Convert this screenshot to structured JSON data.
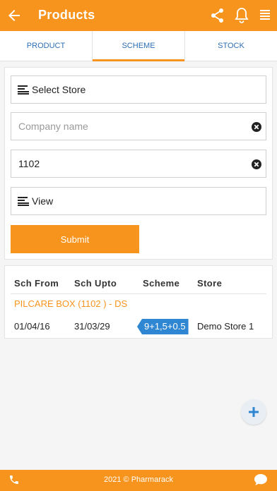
{
  "header": {
    "title": "Products",
    "icons": [
      "back-arrow-icon",
      "share-icon",
      "bell-icon",
      "menu-icon"
    ]
  },
  "tabs": [
    {
      "label": "PRODUCT",
      "active": false
    },
    {
      "label": "SCHEME",
      "active": true
    },
    {
      "label": "STOCK",
      "active": false
    }
  ],
  "form": {
    "store_select": "Select Store",
    "company": {
      "value": "",
      "placeholder": "Company name"
    },
    "code": {
      "value": "1102"
    },
    "view_select": "View",
    "submit_label": "Submit"
  },
  "results": {
    "columns": [
      "Sch From",
      "Sch Upto",
      "Scheme",
      "Store"
    ],
    "product_name": "PILCARE BOX (1102 ) - DS",
    "rows": [
      {
        "sch_from": "01/04/16",
        "sch_upto": "31/03/29",
        "scheme": "9+1,5+0.5",
        "store": "Demo Store 1"
      }
    ]
  },
  "footer": {
    "copyright": "2021 © Pharmarack"
  },
  "colors": {
    "accent": "#f7941d",
    "tab_text": "#2c6fb4",
    "badge": "#2f86d2"
  }
}
